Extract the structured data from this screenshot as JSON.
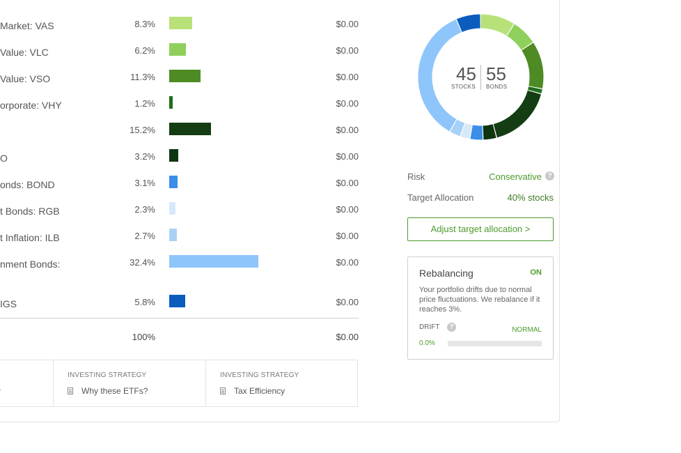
{
  "holdings": [
    {
      "name": "Market: VAS",
      "percent": "8.3%",
      "percent_value": 8.3,
      "amount": "$0.00",
      "color": "#b8e17a"
    },
    {
      "name": "Value: VLC",
      "percent": "6.2%",
      "percent_value": 6.2,
      "amount": "$0.00",
      "color": "#8fd05c"
    },
    {
      "name": "Value: VSO",
      "percent": "11.3%",
      "percent_value": 11.3,
      "amount": "$0.00",
      "color": "#4e8b24"
    },
    {
      "name": "orporate: VHY",
      "percent": "1.2%",
      "percent_value": 1.2,
      "amount": "$0.00",
      "color": "#1e6e1e"
    },
    {
      "name": "",
      "percent": "15.2%",
      "percent_value": 15.2,
      "amount": "$0.00",
      "color": "#143d14"
    },
    {
      "name": "O",
      "percent": "3.2%",
      "percent_value": 3.2,
      "amount": "$0.00",
      "color": "#0f3510"
    },
    {
      "name": "onds: BOND",
      "percent": "3.1%",
      "percent_value": 3.1,
      "amount": "$0.00",
      "color": "#3b8fe8"
    },
    {
      "name": "t Bonds: RGB",
      "percent": "2.3%",
      "percent_value": 2.3,
      "amount": "$0.00",
      "color": "#d6e9fb"
    },
    {
      "name": "t Inflation: ILB",
      "percent": "2.7%",
      "percent_value": 2.7,
      "amount": "$0.00",
      "color": "#a9d1f7"
    },
    {
      "name": "nment Bonds:",
      "percent": "32.4%",
      "percent_value": 32.4,
      "amount": "$0.00",
      "color": "#8ec5fb"
    },
    {
      "name": "IGS",
      "percent": "5.8%",
      "percent_value": 5.8,
      "amount": "$0.00",
      "color": "#0b5cbd"
    }
  ],
  "totals": {
    "percent": "100%",
    "amount": "$0.00"
  },
  "cards": [
    {
      "tag": "INVESTING STRATEGY",
      "link": "Why these ETFs?",
      "icon": "document-icon"
    },
    {
      "tag": "INVESTING STRATEGY",
      "link": "Tax Efficiency",
      "icon": "document-icon"
    }
  ],
  "donut": {
    "stocks_value": "45",
    "stocks_label": "STOCKS",
    "bonds_value": "55",
    "bonds_label": "BONDS"
  },
  "risk": {
    "label": "Risk",
    "value": "Conservative",
    "color": "#4c9a2a",
    "help_icon": "question-icon"
  },
  "target": {
    "label": "Target Allocation",
    "value": "40% stocks",
    "color": "#4c9a2a"
  },
  "adjust_button": "Adjust target allocation >",
  "rebalancing": {
    "title": "Rebalancing",
    "status": "ON",
    "description": "Your portfolio drifts due to normal price fluctuations. We rebalance if it reaches 3%.",
    "drift_label": "DRIFT",
    "drift_status": "NORMAL",
    "drift_value": "0.0%",
    "drift_fraction": 0.0
  }
}
